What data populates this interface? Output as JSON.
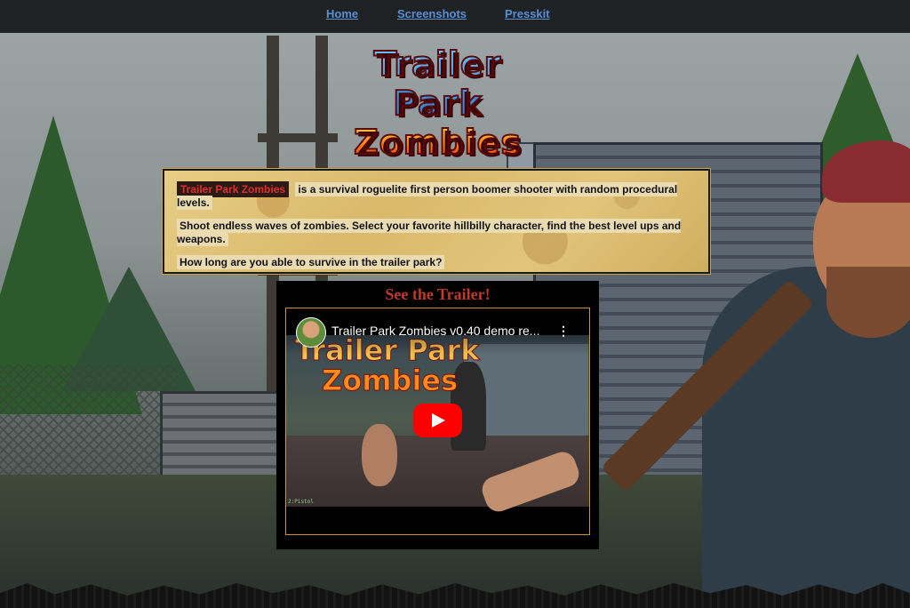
{
  "nav": {
    "items": [
      {
        "label": "Home"
      },
      {
        "label": "Screenshots"
      },
      {
        "label": "Presskit"
      }
    ]
  },
  "logo": {
    "line1": "Trailer Park",
    "line2": "Zombies"
  },
  "description": {
    "game_name": "Trailer Park Zombies",
    "p1_rest": "is a survival roguelite first person boomer shooter with random procedural levels.",
    "p2": "Shoot endless waves of zombies. Select your favorite hillbilly character, find the best level ups and weapons.",
    "p3": "How long are you able to survive in the trailer park?"
  },
  "trailer": {
    "heading": "See the Trailer!",
    "video_title": "Trailer Park Zombies v0.40 demo re...",
    "thumbnail_logo_line1": "Trailer Park",
    "thumbnail_logo_line2": "Zombies",
    "hud_text": "2:Pistol"
  },
  "icons": {
    "play": "youtube-play-icon",
    "menu": "kebab-menu-icon"
  },
  "colors": {
    "nav_bg": "#1f2224",
    "nav_link": "#5a8fd6",
    "accent_red": "#c0392b",
    "youtube_red": "#ff0000",
    "box_border": "#c9982f"
  }
}
